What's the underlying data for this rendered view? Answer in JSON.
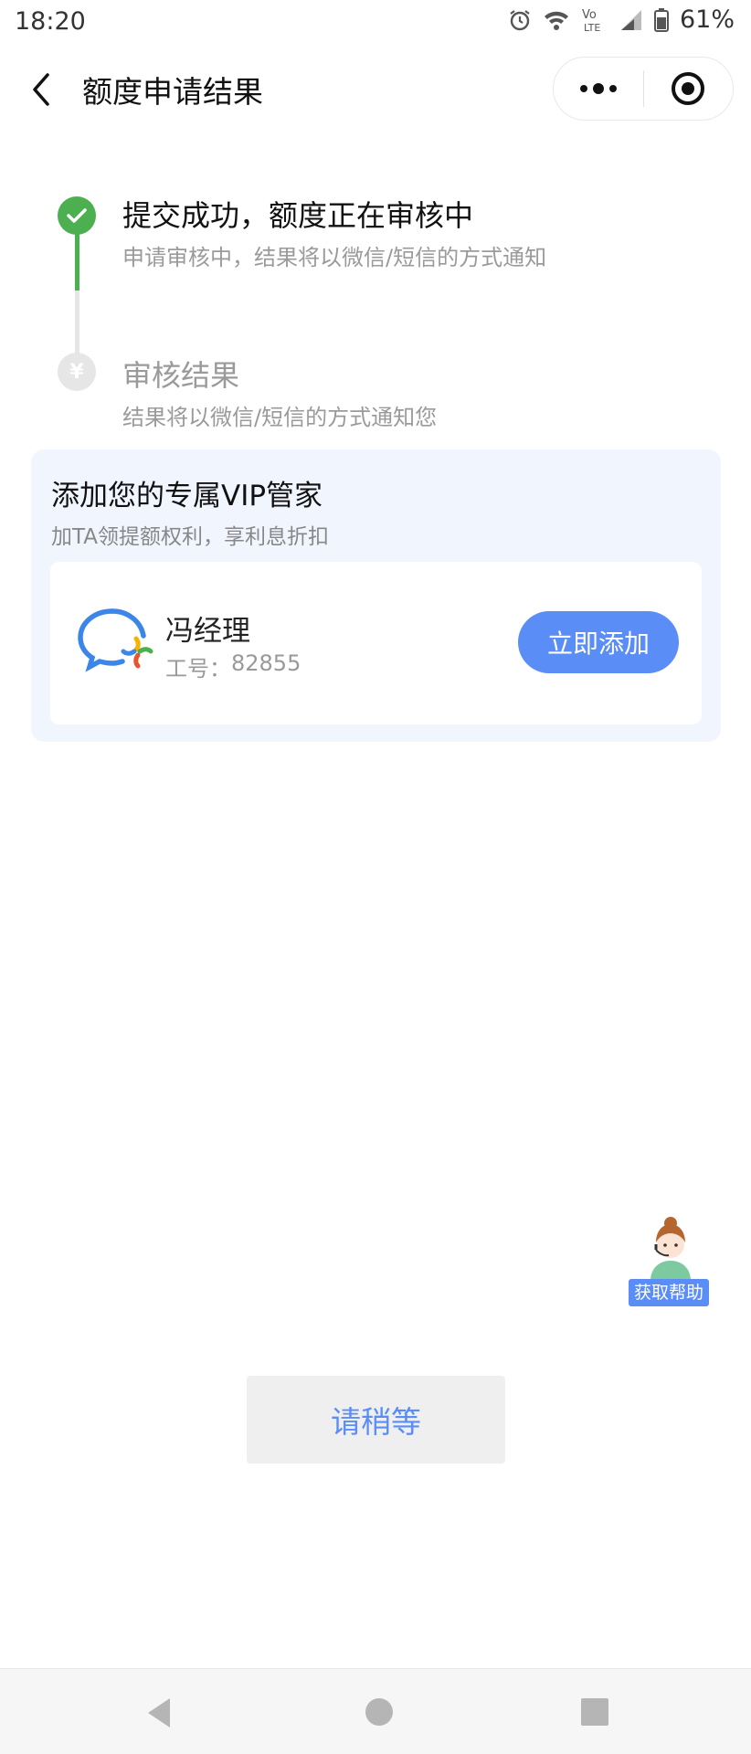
{
  "status_bar": {
    "time": "18:20",
    "battery_text": "61%"
  },
  "header": {
    "title": "额度申请结果"
  },
  "steps": [
    {
      "title": "提交成功，额度正在审核中",
      "description": "申请审核中，结果将以微信/短信的方式通知",
      "status": "done",
      "icon": "check-icon"
    },
    {
      "title": "审核结果",
      "description": "结果将以微信/短信的方式通知您",
      "status": "pending",
      "icon": "yen-icon",
      "icon_glyph": "¥"
    }
  ],
  "vip": {
    "title": "添加您的专属VIP管家",
    "subtitle": "加TA领提额权利，享利息折扣",
    "manager": {
      "name": "冯经理",
      "id_label": "工号：",
      "id_value": "82855",
      "add_label": "立即添加"
    }
  },
  "help": {
    "label": "获取帮助"
  },
  "wait_button": {
    "label": "请稍等"
  },
  "colors": {
    "accent": "#5b8df7",
    "success": "#4caf50",
    "card_bg": "#f1f5fd",
    "muted_text": "#9a9a9a"
  }
}
